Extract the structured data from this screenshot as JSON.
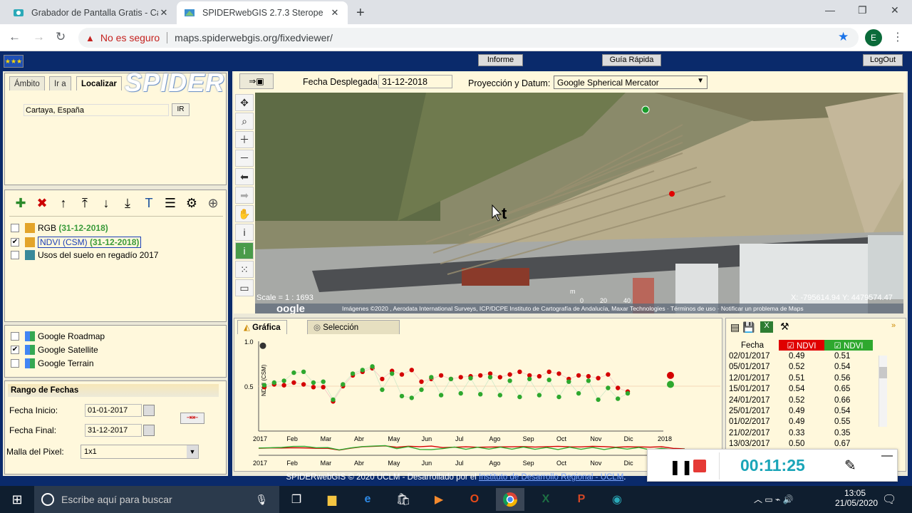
{
  "browser": {
    "tabs": [
      {
        "title": "Grabador de Pantalla Gratis - Cap",
        "active": false
      },
      {
        "title": "SPIDERwebGIS 2.7.3 Sterope",
        "active": true
      }
    ],
    "insecure_label": "No es seguro",
    "url": "maps.spiderwebgis.org/fixedviewer/",
    "avatar_letter": "E"
  },
  "app": {
    "top_buttons": {
      "informe": "Informe",
      "guia": "Guía Rápida",
      "logout": "LogOut"
    },
    "logo_text": "SPIDER",
    "left_tabs": [
      "Ámbito",
      "Ir a",
      "Localizar"
    ],
    "location_value": "Cartaya, España",
    "ir_label": "IR",
    "layers": [
      {
        "name": "RGB",
        "date": "(31-12-2018)",
        "checked": false
      },
      {
        "name": "NDVI (CSM)",
        "date": "(31-12-2018)",
        "checked": true
      },
      {
        "name": "Usos del suelo en regadío 2017",
        "date": "",
        "checked": false
      }
    ],
    "base_layers": [
      {
        "name": "Google Roadmap",
        "checked": false
      },
      {
        "name": "Google Satellite",
        "checked": true
      },
      {
        "name": "Google Terrain",
        "checked": false
      }
    ],
    "date_range": {
      "title": "Rango de Fechas",
      "start_label": "Fecha Inicio:",
      "start_value": "01-01-2017",
      "end_label": "Fecha Final:",
      "end_value": "31-12-2017",
      "pixel_label": "Malla del Pixel:",
      "pixel_value": "1x1"
    },
    "map_header": {
      "date_label": "Fecha Desplegada:",
      "date_value": "31-12-2018",
      "proj_label": "Proyección y Datum:",
      "proj_value": "Google Spherical Mercator"
    },
    "map": {
      "scale": "Scale = 1 : 1693",
      "coords": "X: -795614.94 Y: 4479574.47",
      "attribution": "Imágenes ©2020 , Aerodata International Surveys, ICP/DCPE Instituto de Cartografía de Andalucía, Maxar Technologies · Términos de uso · Notificar un problema de Maps",
      "scalebar_labels": [
        "0",
        "20",
        "40"
      ],
      "m_label": "m"
    },
    "chart_tabs": [
      "Gráfica",
      "Selección"
    ],
    "footer_prefix": "SPIDERwebGIS © 2020 UCLM - Desarrollado por el ",
    "footer_link": "Instituto de Desarrollo Regional - UCLM",
    "footer_suffix": "."
  },
  "chart_data": {
    "type": "scatter",
    "ylabel": "NDVI (CSM)",
    "y_ticks": [
      "1.0",
      "0.5"
    ],
    "ylim": [
      0,
      1.0
    ],
    "x_ticks": [
      "2017",
      "Feb",
      "Mar",
      "Abr",
      "May",
      "Jun",
      "Jul",
      "Ago",
      "Sep",
      "Oct",
      "Nov",
      "Dic",
      "2018"
    ],
    "x_ticks_overview": [
      "2017",
      "Feb",
      "Mar",
      "Abr",
      "May",
      "Jun",
      "Jul",
      "Ago",
      "Sep",
      "Oct",
      "Nov",
      "Dic"
    ],
    "series": [
      {
        "color": "#d40000",
        "values": [
          0.49,
          0.52,
          0.51,
          0.54,
          0.52,
          0.49,
          0.49,
          0.33,
          0.5,
          0.62,
          0.66,
          0.7,
          0.58,
          0.67,
          0.63,
          0.68,
          0.55,
          0.58,
          0.62,
          0.58,
          0.6,
          0.61,
          0.62,
          0.64,
          0.6,
          0.63,
          0.66,
          0.62,
          0.61,
          0.66,
          0.64,
          0.58,
          0.62,
          0.61,
          0.59,
          0.63,
          0.48,
          0.44
        ]
      },
      {
        "color": "#2ea82e",
        "values": [
          0.51,
          0.54,
          0.56,
          0.65,
          0.66,
          0.54,
          0.55,
          0.35,
          0.52,
          0.64,
          0.68,
          0.72,
          0.46,
          0.64,
          0.39,
          0.37,
          0.46,
          0.6,
          0.4,
          0.58,
          0.42,
          0.59,
          0.41,
          0.6,
          0.4,
          0.56,
          0.38,
          0.58,
          0.4,
          0.57,
          0.38,
          0.55,
          0.42,
          0.56,
          0.35,
          0.48,
          0.36,
          0.42
        ]
      }
    ]
  },
  "table": {
    "headers": [
      "Fecha",
      "NDVI",
      "NDVI"
    ],
    "rows": [
      [
        "02/01/2017",
        "0.49",
        "0.51"
      ],
      [
        "05/01/2017",
        "0.52",
        "0.54"
      ],
      [
        "12/01/2017",
        "0.51",
        "0.56"
      ],
      [
        "15/01/2017",
        "0.54",
        "0.65"
      ],
      [
        "24/01/2017",
        "0.52",
        "0.66"
      ],
      [
        "25/01/2017",
        "0.49",
        "0.54"
      ],
      [
        "01/02/2017",
        "0.49",
        "0.55"
      ],
      [
        "21/02/2017",
        "0.33",
        "0.35"
      ],
      [
        "13/03/2017",
        "0.50",
        "0.67"
      ]
    ]
  },
  "recorder": {
    "time": "00:11:25"
  },
  "taskbar": {
    "search_placeholder": "Escribe aquí para buscar",
    "time": "13:05",
    "date": "21/05/2020"
  }
}
